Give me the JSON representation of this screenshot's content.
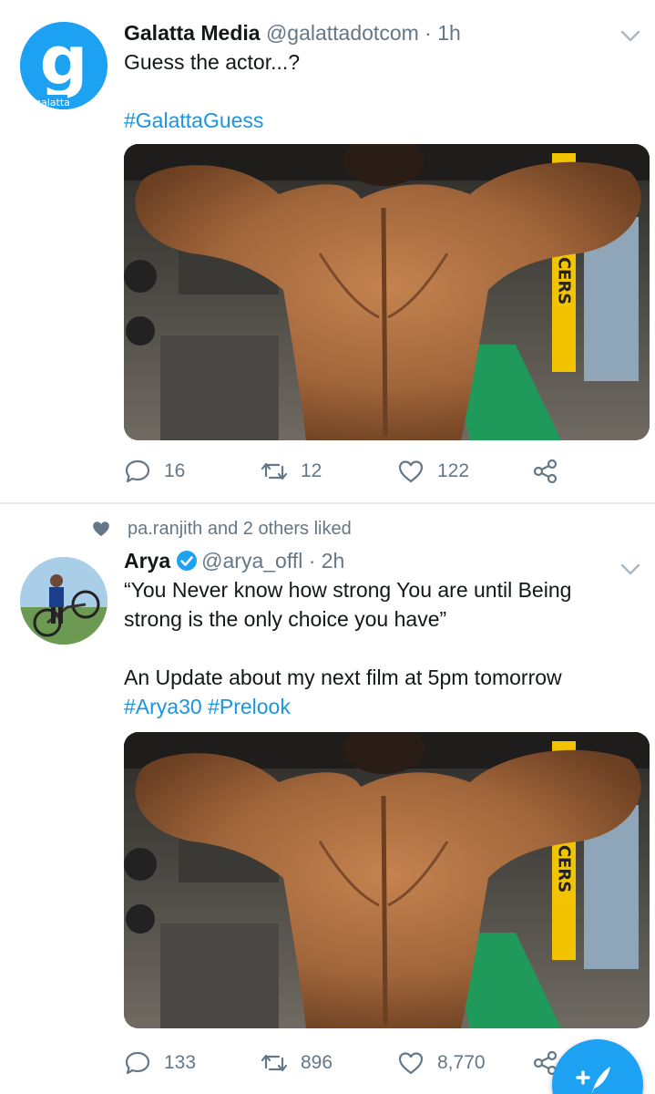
{
  "tweets": [
    {
      "author_name": "Galatta Media",
      "handle": "@galattadotcom",
      "separator": "·",
      "time": "1h",
      "avatar_logo_text": "galatta",
      "text_lines": [
        "Guess the actor...?"
      ],
      "hashtags": [
        "#GalattaGuess"
      ],
      "media_sign_text": "CERS",
      "actions": {
        "replies": "16",
        "retweets": "12",
        "likes": "122"
      }
    },
    {
      "social_context": "pa.ranjith and 2 others liked",
      "author_name": "Arya",
      "verified": true,
      "handle": "@arya_offl",
      "separator": "·",
      "time": "2h",
      "text_lines": [
        "“You Never know how strong You are until Being",
        "strong is the only choice you have”",
        "",
        "An Update about my next film at 5pm tomorrow"
      ],
      "hashtags": [
        "#Arya30",
        "#Prelook"
      ],
      "media_sign_text": "CERS",
      "actions": {
        "replies": "133",
        "retweets": "896",
        "likes": "8,770"
      }
    }
  ],
  "colors": {
    "accent": "#1da1f2",
    "hashtag": "#1b95e0",
    "secondary_text": "#657786",
    "divider": "#e6ecf0"
  },
  "icons": [
    "chevron-down-icon",
    "reply-icon",
    "retweet-icon",
    "like-icon",
    "share-icon",
    "heart-filled-icon",
    "verified-badge-icon",
    "compose-tweet-icon"
  ]
}
